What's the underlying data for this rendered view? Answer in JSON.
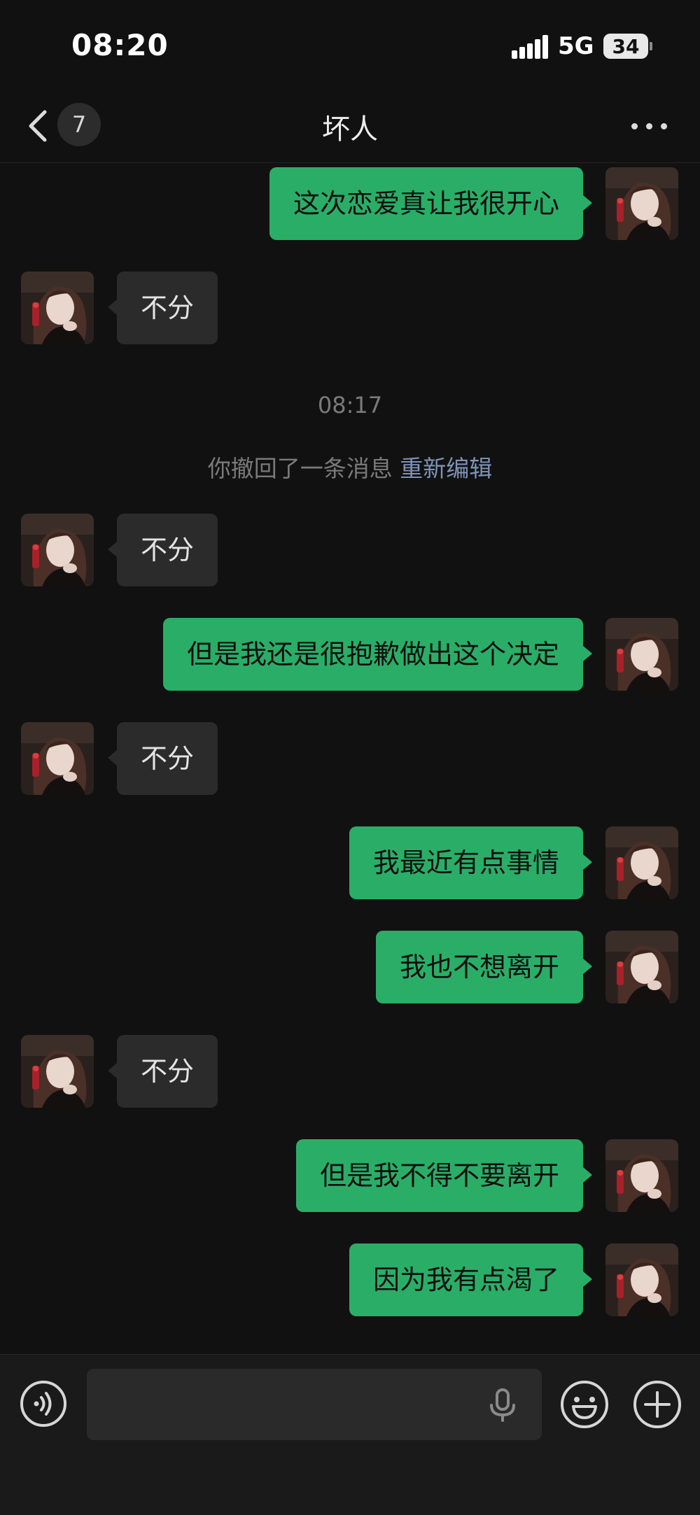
{
  "status_bar": {
    "time": "08:20",
    "network": "5G",
    "battery_percent": "34",
    "battery_level": 0.34
  },
  "header": {
    "unread_count": "7",
    "title": "坏人",
    "back_icon": "chevron-left-icon",
    "more_icon": "more-dots-icon"
  },
  "messages": [
    {
      "direction": "out",
      "text": "这次恋爱真让我很开心"
    },
    {
      "direction": "in",
      "text": "不分"
    },
    {
      "direction": "in",
      "text": "不分"
    },
    {
      "direction": "out",
      "text": "但是我还是很抱歉做出这个决定"
    },
    {
      "direction": "in",
      "text": "不分"
    },
    {
      "direction": "out",
      "text": "我最近有点事情"
    },
    {
      "direction": "out",
      "text": "我也不想离开"
    },
    {
      "direction": "in",
      "text": "不分"
    },
    {
      "direction": "out",
      "text": "但是我不得不要离开"
    },
    {
      "direction": "out",
      "text": "因为我有点渴了"
    }
  ],
  "timestamp": "08:17",
  "system_note": {
    "text": "你撤回了一条消息",
    "link": "重新编辑"
  },
  "input_bar": {
    "placeholder": "",
    "voice_icon": "voice-toggle-icon",
    "mic_icon": "microphone-icon",
    "emoji_icon": "emoji-icon",
    "plus_icon": "plus-icon"
  },
  "colors": {
    "background": "#111111",
    "outgoing_bubble": "#2aae67",
    "incoming_bubble": "#2b2b2b",
    "link": "#7e93b6"
  }
}
